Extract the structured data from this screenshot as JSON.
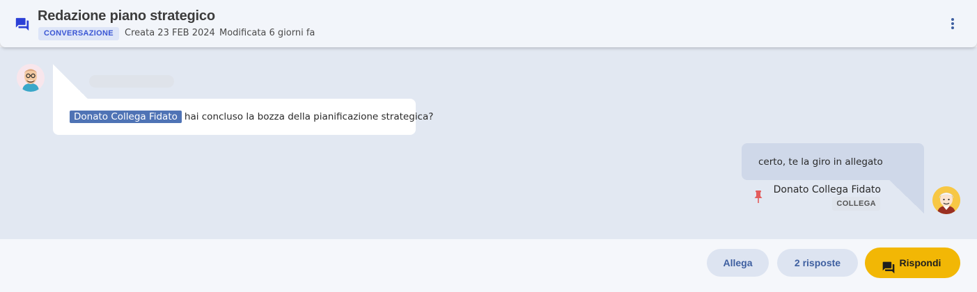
{
  "header": {
    "title": "Redazione piano strategico",
    "type_badge": "CONVERSAZIONE",
    "created": "Creata 23 FEB 2024",
    "modified": "Modificata 6 giorni fa",
    "icon": "forum-icon",
    "menu_icon": "more-vert-icon"
  },
  "messages": [
    {
      "direction": "incoming",
      "mention": "Donato Collega Fidato",
      "text": "hai concluso la bozza della pianificazione strategica?"
    },
    {
      "direction": "outgoing",
      "text": "certo, te la giro in allegato",
      "sender": "Donato Collega Fidato",
      "role": "COLLEGA",
      "pinned_icon": "pin-icon"
    }
  ],
  "footer": {
    "attach_label": "Allega",
    "replies_label": "2 risposte",
    "reply_label": "Rispondi"
  },
  "colors": {
    "accent_blue": "#2b3fd6",
    "reply_button": "#f2b705",
    "mention_bg": "#4f73b5",
    "pin": "#e35d5d"
  }
}
